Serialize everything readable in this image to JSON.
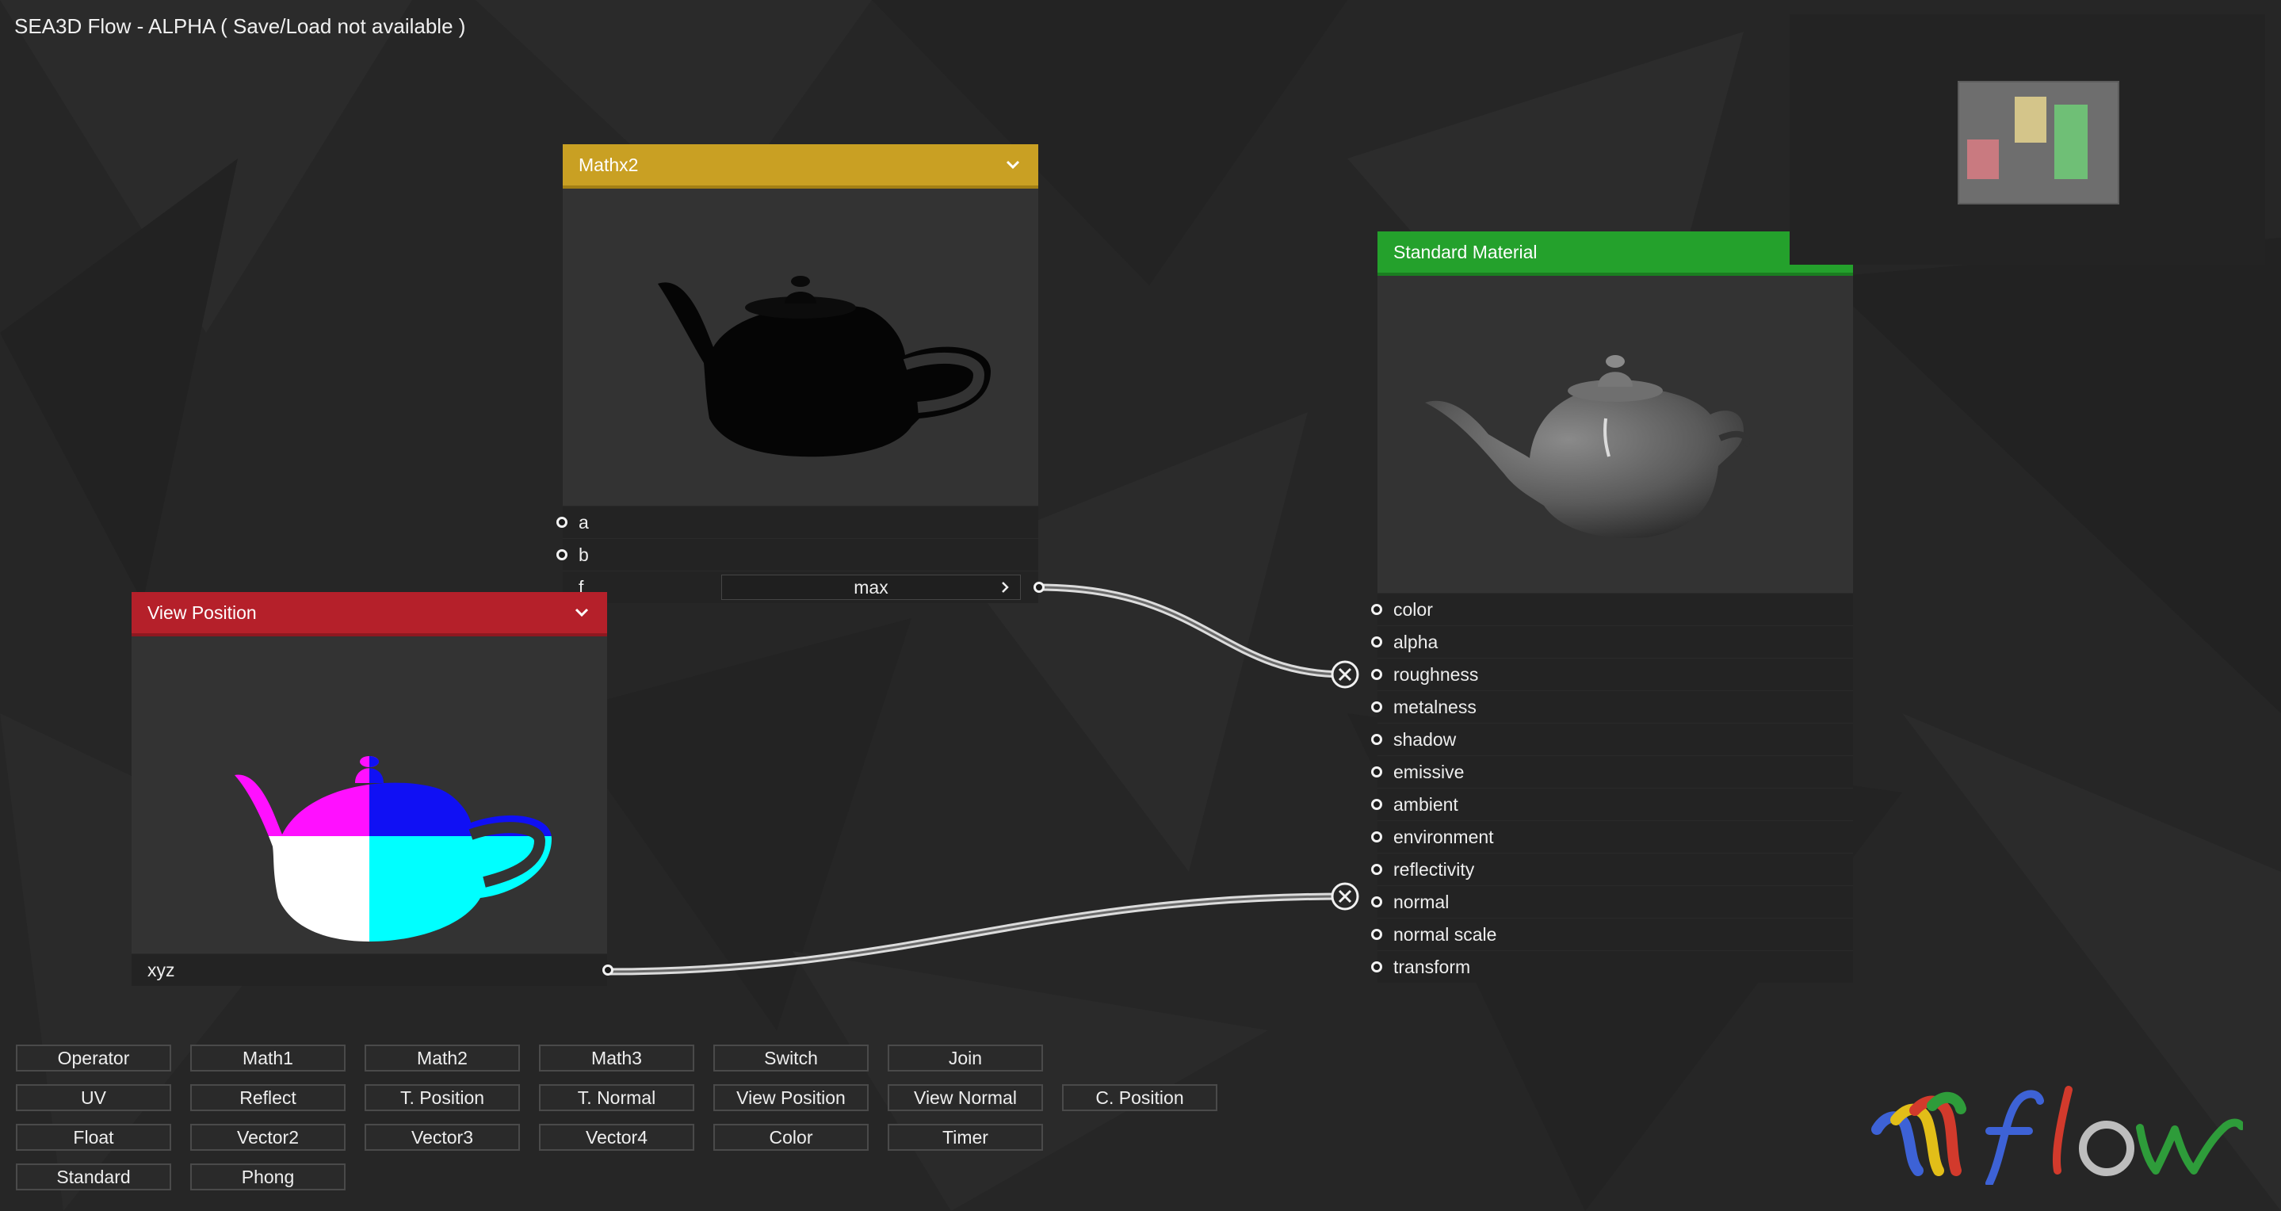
{
  "app": {
    "title": "SEA3D Flow - ALPHA ( Save/Load not available )"
  },
  "colors": {
    "background": "#262626",
    "mathx2_header": "#c9a023",
    "view_position_header": "#b5202a",
    "standard_material_header": "#24a12c"
  },
  "nodes": {
    "mathx2": {
      "title": "Mathx2",
      "inputs": [
        "a",
        "b"
      ],
      "f_label": "f",
      "f_value": "max"
    },
    "view_position": {
      "title": "View Position",
      "output": "xyz"
    },
    "standard_material": {
      "title": "Standard Material",
      "inputs": [
        "color",
        "alpha",
        "roughness",
        "metalness",
        "shadow",
        "emissive",
        "ambient",
        "environment",
        "reflectivity",
        "normal",
        "normal scale",
        "transform"
      ]
    }
  },
  "toolbar": {
    "row1": [
      "Operator",
      "Math1",
      "Math2",
      "Math3",
      "Switch",
      "Join"
    ],
    "row2": [
      "UV",
      "Reflect",
      "T. Position",
      "T. Normal",
      "View Position",
      "View Normal",
      "C. Position"
    ],
    "row3": [
      "Float",
      "Vector2",
      "Vector3",
      "Vector4",
      "Color",
      "Timer"
    ],
    "row4": [
      "Standard",
      "Phong"
    ]
  },
  "logo": {
    "text": "flow"
  }
}
